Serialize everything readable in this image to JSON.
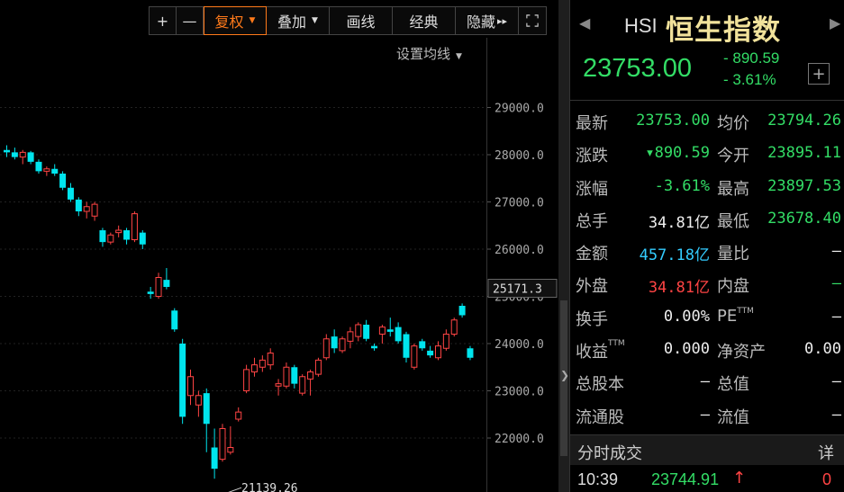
{
  "toolbar": {
    "plus": "+",
    "minus": "—",
    "restore_rights": "复权",
    "overlay": "叠加",
    "draw_line": "画线",
    "classic": "经典",
    "hide": "隐藏",
    "hide_arrows": "▸▸",
    "fullscreen": "⛶"
  },
  "ma_setting": "设置均线",
  "price_axis": {
    "ticks": [
      29000,
      28000,
      27000,
      26000,
      25000,
      24000,
      23000,
      22000
    ],
    "tick_labels": [
      "29000.0",
      "28000.0",
      "27000.0",
      "26000.0",
      "25000.0",
      "24000.0",
      "23000.0",
      "22000.0"
    ],
    "current_marker": "25171.3",
    "low_annotation": "21139.26"
  },
  "colors": {
    "up": "#ff4444",
    "down": "#00e5ee",
    "accent": "#ff7a1a",
    "title": "#f1e29b"
  },
  "candles": [
    [
      28100,
      28200,
      27950,
      28050
    ],
    [
      28050,
      28150,
      27900,
      27950
    ],
    [
      27950,
      28100,
      27800,
      28050
    ],
    [
      28050,
      28080,
      27800,
      27850
    ],
    [
      27850,
      27900,
      27600,
      27650
    ],
    [
      27650,
      27750,
      27550,
      27700
    ],
    [
      27700,
      27800,
      27550,
      27600
    ],
    [
      27600,
      27650,
      27250,
      27300
    ],
    [
      27300,
      27400,
      27000,
      27050
    ],
    [
      27050,
      27100,
      26700,
      26800
    ],
    [
      26800,
      27000,
      26650,
      26900
    ],
    [
      26700,
      27000,
      26600,
      26950
    ],
    [
      26400,
      26450,
      26050,
      26150
    ],
    [
      26150,
      26350,
      26100,
      26300
    ],
    [
      26350,
      26500,
      26250,
      26400
    ],
    [
      26400,
      26450,
      26100,
      26200
    ],
    [
      26200,
      26800,
      26150,
      26750
    ],
    [
      26350,
      26400,
      26000,
      26100
    ],
    [
      25100,
      25200,
      24950,
      25050
    ],
    [
      25000,
      25500,
      24950,
      25400
    ],
    [
      25350,
      25600,
      25150,
      25200
    ],
    [
      24700,
      24750,
      24250,
      24300
    ],
    [
      24000,
      24100,
      22300,
      22450
    ],
    [
      22900,
      23450,
      22700,
      23300
    ],
    [
      22700,
      23000,
      22450,
      22900
    ],
    [
      22950,
      23050,
      21700,
      22300
    ],
    [
      21800,
      22200,
      21139,
      21350
    ],
    [
      21550,
      22300,
      21500,
      22200
    ],
    [
      21700,
      22250,
      21650,
      21800
    ],
    [
      22400,
      22650,
      22350,
      22550
    ],
    [
      23000,
      23550,
      22950,
      23450
    ],
    [
      23400,
      23700,
      23300,
      23550
    ],
    [
      23500,
      23750,
      23400,
      23650
    ],
    [
      23550,
      23900,
      23450,
      23800
    ],
    [
      23100,
      23250,
      22900,
      23150
    ],
    [
      23100,
      23600,
      23050,
      23500
    ],
    [
      23500,
      23550,
      23050,
      23150
    ],
    [
      22950,
      23350,
      22900,
      23300
    ],
    [
      23250,
      23450,
      22900,
      23400
    ],
    [
      23350,
      23700,
      23300,
      23650
    ],
    [
      23700,
      24200,
      23650,
      24100
    ],
    [
      24150,
      24300,
      23800,
      23900
    ],
    [
      23850,
      24150,
      23800,
      24100
    ],
    [
      24050,
      24350,
      23900,
      24250
    ],
    [
      24150,
      24450,
      24050,
      24400
    ],
    [
      24400,
      24500,
      24050,
      24100
    ],
    [
      23950,
      24000,
      23850,
      23900
    ],
    [
      24200,
      24400,
      24000,
      24350
    ],
    [
      24300,
      24550,
      24150,
      24250
    ],
    [
      24350,
      24450,
      24000,
      24050
    ],
    [
      24200,
      24250,
      23600,
      23700
    ],
    [
      23500,
      24000,
      23450,
      23950
    ],
    [
      24050,
      24100,
      23850,
      23900
    ],
    [
      23850,
      23950,
      23700,
      23750
    ],
    [
      23700,
      24050,
      23650,
      23950
    ],
    [
      23900,
      24300,
      23850,
      24200
    ],
    [
      24200,
      24550,
      24150,
      24500
    ],
    [
      24800,
      24850,
      24550,
      24600
    ],
    [
      23900,
      23950,
      23650,
      23700
    ]
  ],
  "panel": {
    "code": "HSI",
    "name": "恒生指数",
    "last": "23753.00",
    "change": "- 890.59",
    "change_pct": "- 3.61%",
    "plus_btn": "+",
    "rows": [
      {
        "l1": "最新",
        "v1": "23753.00",
        "c1": "green",
        "l2": "均价",
        "v2": "23794.26",
        "c2": "green"
      },
      {
        "l1": "涨跌",
        "v1": "▾890.59",
        "c1": "green",
        "l2": "今开",
        "v2": "23895.11",
        "c2": "green"
      },
      {
        "l1": "涨幅",
        "v1": "-3.61%",
        "c1": "green",
        "l2": "最高",
        "v2": "23897.53",
        "c2": "green"
      },
      {
        "l1": "总手",
        "v1": "34.81亿",
        "c1": "white",
        "l2": "最低",
        "v2": "23678.40",
        "c2": "green"
      },
      {
        "l1": "金额",
        "v1": "457.18亿",
        "c1": "cyan",
        "l2": "量比",
        "v2": "—",
        "c2": "white"
      },
      {
        "l1": "外盘",
        "v1": "34.81亿",
        "c1": "red",
        "l2": "内盘",
        "v2": "—",
        "c2": "green"
      },
      {
        "l1": "换手",
        "v1": "0.00%",
        "c1": "white",
        "l2": "PE",
        "l2sup": "TTM",
        "v2": "—",
        "c2": "white"
      },
      {
        "l1": "收益",
        "l1sup": "TTM",
        "v1": "0.000",
        "c1": "white",
        "l2": "净资产",
        "v2": "0.00",
        "c2": "white"
      },
      {
        "l1": "总股本",
        "v1": "—",
        "c1": "white",
        "l2": "总值",
        "v2": "—",
        "c2": "white"
      },
      {
        "l1": "流通股",
        "v1": "—",
        "c1": "white",
        "l2": "流值",
        "v2": "—",
        "c2": "white"
      }
    ],
    "tick_title": "分时成交",
    "tick_detail": "详",
    "tick": {
      "time": "10:39",
      "price": "23744.91",
      "arrow": "↑",
      "vol": "0"
    }
  }
}
